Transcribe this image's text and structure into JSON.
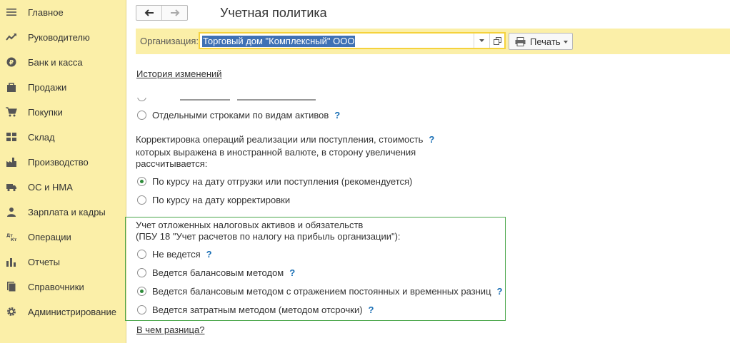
{
  "sidebar": {
    "items": [
      {
        "label": "Главное",
        "icon": "menu-icon"
      },
      {
        "label": "Руководителю",
        "icon": "trend-icon"
      },
      {
        "label": "Банк и касса",
        "icon": "ruble-icon"
      },
      {
        "label": "Продажи",
        "icon": "bag-icon"
      },
      {
        "label": "Покупки",
        "icon": "cart-icon"
      },
      {
        "label": "Склад",
        "icon": "warehouse-icon"
      },
      {
        "label": "Производство",
        "icon": "factory-icon"
      },
      {
        "label": "ОС и НМА",
        "icon": "truck-icon"
      },
      {
        "label": "Зарплата и кадры",
        "icon": "person-icon"
      },
      {
        "label": "Операции",
        "icon": "debit-credit-icon"
      },
      {
        "label": "Отчеты",
        "icon": "bar-chart-icon"
      },
      {
        "label": "Справочники",
        "icon": "books-icon"
      },
      {
        "label": "Администрирование",
        "icon": "gear-icon"
      }
    ]
  },
  "header": {
    "title": "Учетная политика"
  },
  "org": {
    "label": "Организация:",
    "value": "Торговый дом \"Комплексный\" ООО",
    "print_label": "Печать"
  },
  "links": {
    "history": "История изменений",
    "difference": "В чем разница?"
  },
  "assets": {
    "option_separate": "Отдельными строками по видам активов"
  },
  "currency": {
    "text_line1": "Корректировка операций реализации или поступления, стоимость",
    "text_line2": "которых выражена в иностранной валюте, в сторону увеличения",
    "text_line3": "рассчитывается:",
    "options": [
      {
        "label": "По курсу на дату отгрузки или поступления (рекомендуется)",
        "selected": true
      },
      {
        "label": "По курсу на дату корректировки",
        "selected": false
      }
    ]
  },
  "deferred_tax": {
    "title_line1": "Учет отложенных налоговых активов и обязательств",
    "title_line2": "(ПБУ 18 \"Учет расчетов по налогу на прибыль организации\"):",
    "options": [
      {
        "label": "Не ведется",
        "selected": false
      },
      {
        "label": "Ведется балансовым методом",
        "selected": false
      },
      {
        "label": "Ведется балансовым методом с отражением постоянных и временных разниц",
        "selected": true
      },
      {
        "label": "Ведется затратным методом (методом отсрочки)",
        "selected": false
      }
    ]
  },
  "help_glyph": "?",
  "colors": {
    "sidebar_bg": "#fbefa8",
    "accent_green": "#4aa64a",
    "link": "#1a4f93",
    "selection": "#3f71b5"
  }
}
